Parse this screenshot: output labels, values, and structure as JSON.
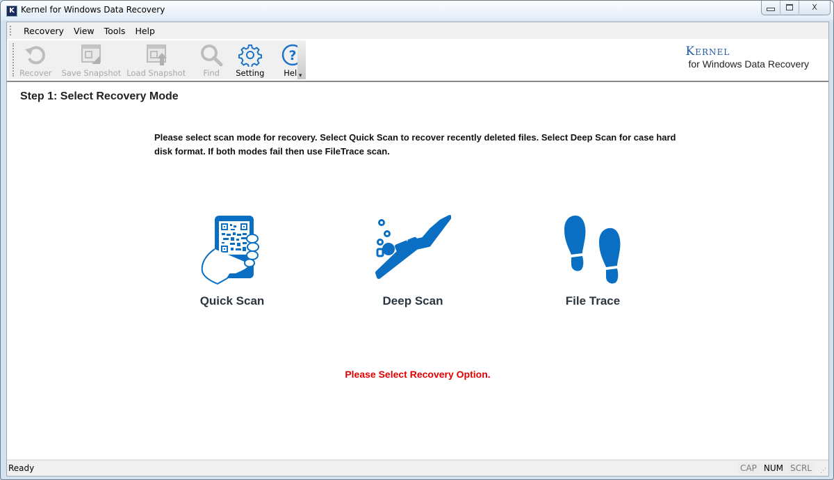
{
  "window": {
    "title": "Kernel for Windows Data Recovery",
    "app_icon_letter": "K",
    "controls": {
      "minimize": "minimize",
      "maximize": "maximize",
      "close": "X"
    }
  },
  "menu": {
    "items": [
      {
        "label": "Recovery"
      },
      {
        "label": "View"
      },
      {
        "label": "Tools"
      },
      {
        "label": "Help"
      }
    ]
  },
  "toolbar": {
    "buttons": [
      {
        "label": "Recover",
        "icon": "undo-arrow-icon",
        "enabled": false
      },
      {
        "label": "Save Snapshot",
        "icon": "save-snapshot-icon",
        "enabled": false
      },
      {
        "label": "Load Snapshot",
        "icon": "load-snapshot-icon",
        "enabled": false
      },
      {
        "label": "Find",
        "icon": "magnifier-icon",
        "enabled": false
      },
      {
        "label": "Setting",
        "icon": "gear-icon",
        "enabled": true
      },
      {
        "label": "Help",
        "icon": "question-circle-icon",
        "enabled": true
      }
    ]
  },
  "brand": {
    "name": "Kernel",
    "subtitle": "for Windows Data Recovery",
    "color": "#1c5aa8"
  },
  "main": {
    "step_title": "Step 1: Select Recovery Mode",
    "instructions": "Please select scan mode for recovery. Select Quick Scan to recover recently deleted files. Select Deep Scan for case hard disk format. If both modes fail then use FileTrace scan.",
    "options": [
      {
        "label": "Quick Scan",
        "icon": "hand-phone-qr-icon"
      },
      {
        "label": "Deep Scan",
        "icon": "diver-icon"
      },
      {
        "label": "File Trace",
        "icon": "footprints-icon"
      }
    ],
    "icon_color": "#0a6fc2",
    "status_message": "Please Select Recovery Option.",
    "status_color": "#e00000"
  },
  "statusbar": {
    "text": "Ready",
    "indicators": [
      {
        "label": "CAP",
        "active": false
      },
      {
        "label": "NUM",
        "active": true
      },
      {
        "label": "SCRL",
        "active": false
      }
    ]
  }
}
